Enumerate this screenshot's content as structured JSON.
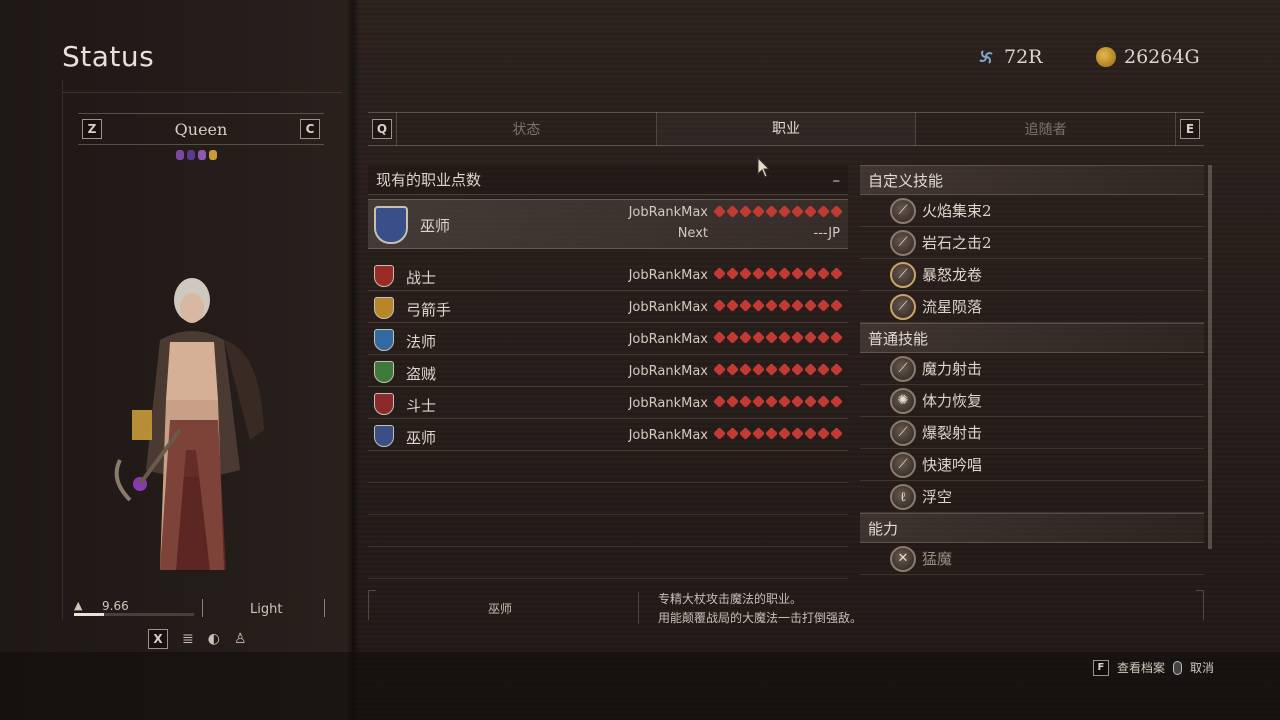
{
  "header": {
    "title": "Status",
    "currency_r": "72R",
    "currency_g": "26264G"
  },
  "character": {
    "prev_key": "Z",
    "next_key": "C",
    "name": "Queen",
    "weight_value": "9.66",
    "weight_class": "Light",
    "weight_fraction": 0.25,
    "controls_key": "X"
  },
  "tabs": {
    "left_key": "Q",
    "right_key": "E",
    "items": [
      {
        "label": "状态",
        "active": false
      },
      {
        "label": "职业",
        "active": true
      },
      {
        "label": "追随者",
        "active": false
      }
    ]
  },
  "jobs": {
    "header": "现有的职业点数",
    "collapse_symbol": "–",
    "current": {
      "name": "巫师",
      "rank": "JobRankMax",
      "next_label": "Next",
      "next_value": "---JP",
      "color": "#3a4f8a"
    },
    "list": [
      {
        "name": "战士",
        "rank": "JobRankMax",
        "color": "#9a2a26"
      },
      {
        "name": "弓箭手",
        "rank": "JobRankMax",
        "color": "#b8862a"
      },
      {
        "name": "法师",
        "rank": "JobRankMax",
        "color": "#2f6aa0"
      },
      {
        "name": "盗贼",
        "rank": "JobRankMax",
        "color": "#3e7a3a"
      },
      {
        "name": "斗士",
        "rank": "JobRankMax",
        "color": "#8a2a2a"
      },
      {
        "name": "巫师",
        "rank": "JobRankMax",
        "color": "#3a4f8a"
      }
    ],
    "star_color": "#c23a34"
  },
  "skills": {
    "custom_header": "自定义技能",
    "custom": [
      {
        "label": "火焰集束2",
        "gold": false
      },
      {
        "label": "岩石之击2",
        "gold": false
      },
      {
        "label": "暴怒龙卷",
        "gold": true
      },
      {
        "label": "流星陨落",
        "gold": true
      }
    ],
    "normal_header": "普通技能",
    "normal": [
      {
        "label": "魔力射击"
      },
      {
        "label": "体力恢复"
      },
      {
        "label": "爆裂射击"
      },
      {
        "label": "快速吟唱"
      },
      {
        "label": "浮空"
      }
    ],
    "ability_header": "能力",
    "abilities": [
      {
        "label": "猛魔"
      }
    ]
  },
  "description": {
    "title": "巫师",
    "line1": "专精大杖攻击魔法的职业。",
    "line2": "用能颠覆战局的大魔法一击打倒强敌。"
  },
  "hints": {
    "profile_key": "F",
    "profile_label": "查看档案",
    "cancel_label": "取消"
  }
}
